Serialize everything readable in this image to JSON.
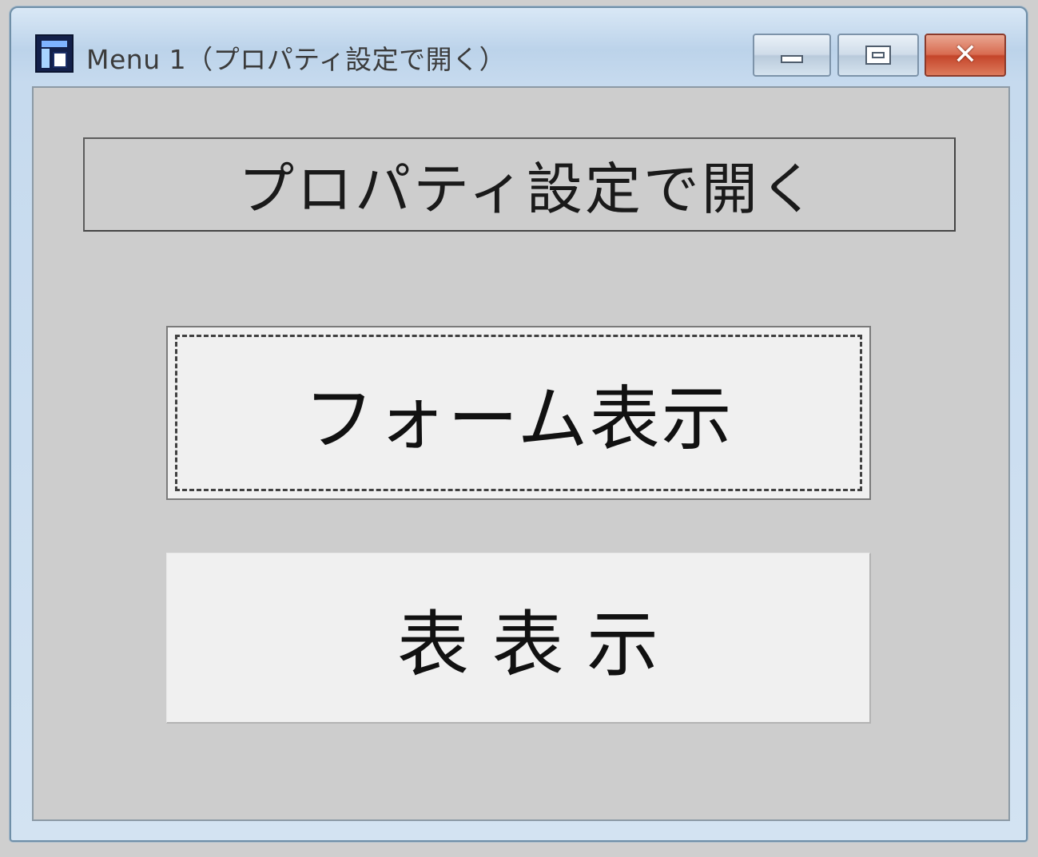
{
  "window": {
    "title": "Menu 1（プロパティ設定で開く）",
    "icon": "app-icon",
    "controls": {
      "minimize_icon": "minimize-icon",
      "maximize_icon": "maximize-icon",
      "close_icon": "close-icon",
      "close_glyph": "✕"
    }
  },
  "content": {
    "heading": "プロパティ設定で開く",
    "buttons": {
      "form_display": "フォーム表示",
      "table_display": "表 表 示"
    }
  },
  "colors": {
    "client_background": "#cdcdcd",
    "button_face": "#f0f0f0",
    "close_button": "#c4452a"
  }
}
